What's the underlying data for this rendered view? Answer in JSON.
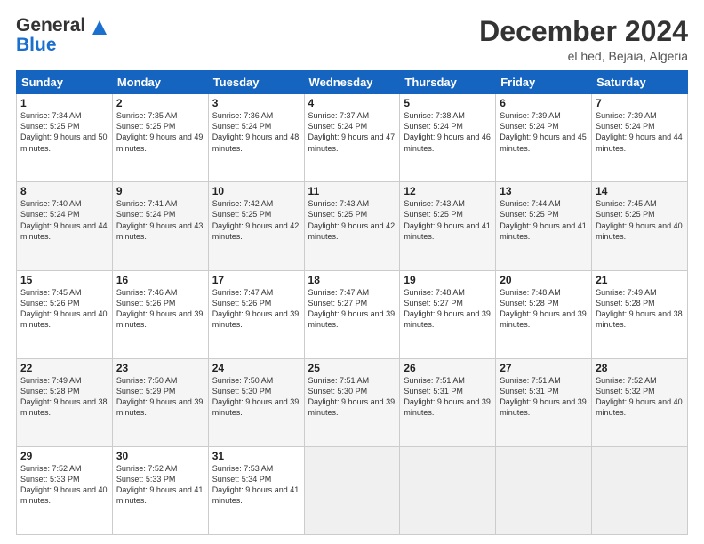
{
  "header": {
    "logo_line1": "General",
    "logo_line2": "Blue",
    "month": "December 2024",
    "location": "el hed, Bejaia, Algeria"
  },
  "weekdays": [
    "Sunday",
    "Monday",
    "Tuesday",
    "Wednesday",
    "Thursday",
    "Friday",
    "Saturday"
  ],
  "weeks": [
    [
      {
        "day": "1",
        "sunrise": "Sunrise: 7:34 AM",
        "sunset": "Sunset: 5:25 PM",
        "daylight": "Daylight: 9 hours and 50 minutes."
      },
      {
        "day": "2",
        "sunrise": "Sunrise: 7:35 AM",
        "sunset": "Sunset: 5:25 PM",
        "daylight": "Daylight: 9 hours and 49 minutes."
      },
      {
        "day": "3",
        "sunrise": "Sunrise: 7:36 AM",
        "sunset": "Sunset: 5:24 PM",
        "daylight": "Daylight: 9 hours and 48 minutes."
      },
      {
        "day": "4",
        "sunrise": "Sunrise: 7:37 AM",
        "sunset": "Sunset: 5:24 PM",
        "daylight": "Daylight: 9 hours and 47 minutes."
      },
      {
        "day": "5",
        "sunrise": "Sunrise: 7:38 AM",
        "sunset": "Sunset: 5:24 PM",
        "daylight": "Daylight: 9 hours and 46 minutes."
      },
      {
        "day": "6",
        "sunrise": "Sunrise: 7:39 AM",
        "sunset": "Sunset: 5:24 PM",
        "daylight": "Daylight: 9 hours and 45 minutes."
      },
      {
        "day": "7",
        "sunrise": "Sunrise: 7:39 AM",
        "sunset": "Sunset: 5:24 PM",
        "daylight": "Daylight: 9 hours and 44 minutes."
      }
    ],
    [
      {
        "day": "8",
        "sunrise": "Sunrise: 7:40 AM",
        "sunset": "Sunset: 5:24 PM",
        "daylight": "Daylight: 9 hours and 44 minutes."
      },
      {
        "day": "9",
        "sunrise": "Sunrise: 7:41 AM",
        "sunset": "Sunset: 5:24 PM",
        "daylight": "Daylight: 9 hours and 43 minutes."
      },
      {
        "day": "10",
        "sunrise": "Sunrise: 7:42 AM",
        "sunset": "Sunset: 5:25 PM",
        "daylight": "Daylight: 9 hours and 42 minutes."
      },
      {
        "day": "11",
        "sunrise": "Sunrise: 7:43 AM",
        "sunset": "Sunset: 5:25 PM",
        "daylight": "Daylight: 9 hours and 42 minutes."
      },
      {
        "day": "12",
        "sunrise": "Sunrise: 7:43 AM",
        "sunset": "Sunset: 5:25 PM",
        "daylight": "Daylight: 9 hours and 41 minutes."
      },
      {
        "day": "13",
        "sunrise": "Sunrise: 7:44 AM",
        "sunset": "Sunset: 5:25 PM",
        "daylight": "Daylight: 9 hours and 41 minutes."
      },
      {
        "day": "14",
        "sunrise": "Sunrise: 7:45 AM",
        "sunset": "Sunset: 5:25 PM",
        "daylight": "Daylight: 9 hours and 40 minutes."
      }
    ],
    [
      {
        "day": "15",
        "sunrise": "Sunrise: 7:45 AM",
        "sunset": "Sunset: 5:26 PM",
        "daylight": "Daylight: 9 hours and 40 minutes."
      },
      {
        "day": "16",
        "sunrise": "Sunrise: 7:46 AM",
        "sunset": "Sunset: 5:26 PM",
        "daylight": "Daylight: 9 hours and 39 minutes."
      },
      {
        "day": "17",
        "sunrise": "Sunrise: 7:47 AM",
        "sunset": "Sunset: 5:26 PM",
        "daylight": "Daylight: 9 hours and 39 minutes."
      },
      {
        "day": "18",
        "sunrise": "Sunrise: 7:47 AM",
        "sunset": "Sunset: 5:27 PM",
        "daylight": "Daylight: 9 hours and 39 minutes."
      },
      {
        "day": "19",
        "sunrise": "Sunrise: 7:48 AM",
        "sunset": "Sunset: 5:27 PM",
        "daylight": "Daylight: 9 hours and 39 minutes."
      },
      {
        "day": "20",
        "sunrise": "Sunrise: 7:48 AM",
        "sunset": "Sunset: 5:28 PM",
        "daylight": "Daylight: 9 hours and 39 minutes."
      },
      {
        "day": "21",
        "sunrise": "Sunrise: 7:49 AM",
        "sunset": "Sunset: 5:28 PM",
        "daylight": "Daylight: 9 hours and 38 minutes."
      }
    ],
    [
      {
        "day": "22",
        "sunrise": "Sunrise: 7:49 AM",
        "sunset": "Sunset: 5:28 PM",
        "daylight": "Daylight: 9 hours and 38 minutes."
      },
      {
        "day": "23",
        "sunrise": "Sunrise: 7:50 AM",
        "sunset": "Sunset: 5:29 PM",
        "daylight": "Daylight: 9 hours and 39 minutes."
      },
      {
        "day": "24",
        "sunrise": "Sunrise: 7:50 AM",
        "sunset": "Sunset: 5:30 PM",
        "daylight": "Daylight: 9 hours and 39 minutes."
      },
      {
        "day": "25",
        "sunrise": "Sunrise: 7:51 AM",
        "sunset": "Sunset: 5:30 PM",
        "daylight": "Daylight: 9 hours and 39 minutes."
      },
      {
        "day": "26",
        "sunrise": "Sunrise: 7:51 AM",
        "sunset": "Sunset: 5:31 PM",
        "daylight": "Daylight: 9 hours and 39 minutes."
      },
      {
        "day": "27",
        "sunrise": "Sunrise: 7:51 AM",
        "sunset": "Sunset: 5:31 PM",
        "daylight": "Daylight: 9 hours and 39 minutes."
      },
      {
        "day": "28",
        "sunrise": "Sunrise: 7:52 AM",
        "sunset": "Sunset: 5:32 PM",
        "daylight": "Daylight: 9 hours and 40 minutes."
      }
    ],
    [
      {
        "day": "29",
        "sunrise": "Sunrise: 7:52 AM",
        "sunset": "Sunset: 5:33 PM",
        "daylight": "Daylight: 9 hours and 40 minutes."
      },
      {
        "day": "30",
        "sunrise": "Sunrise: 7:52 AM",
        "sunset": "Sunset: 5:33 PM",
        "daylight": "Daylight: 9 hours and 41 minutes."
      },
      {
        "day": "31",
        "sunrise": "Sunrise: 7:53 AM",
        "sunset": "Sunset: 5:34 PM",
        "daylight": "Daylight: 9 hours and 41 minutes."
      },
      null,
      null,
      null,
      null
    ]
  ]
}
